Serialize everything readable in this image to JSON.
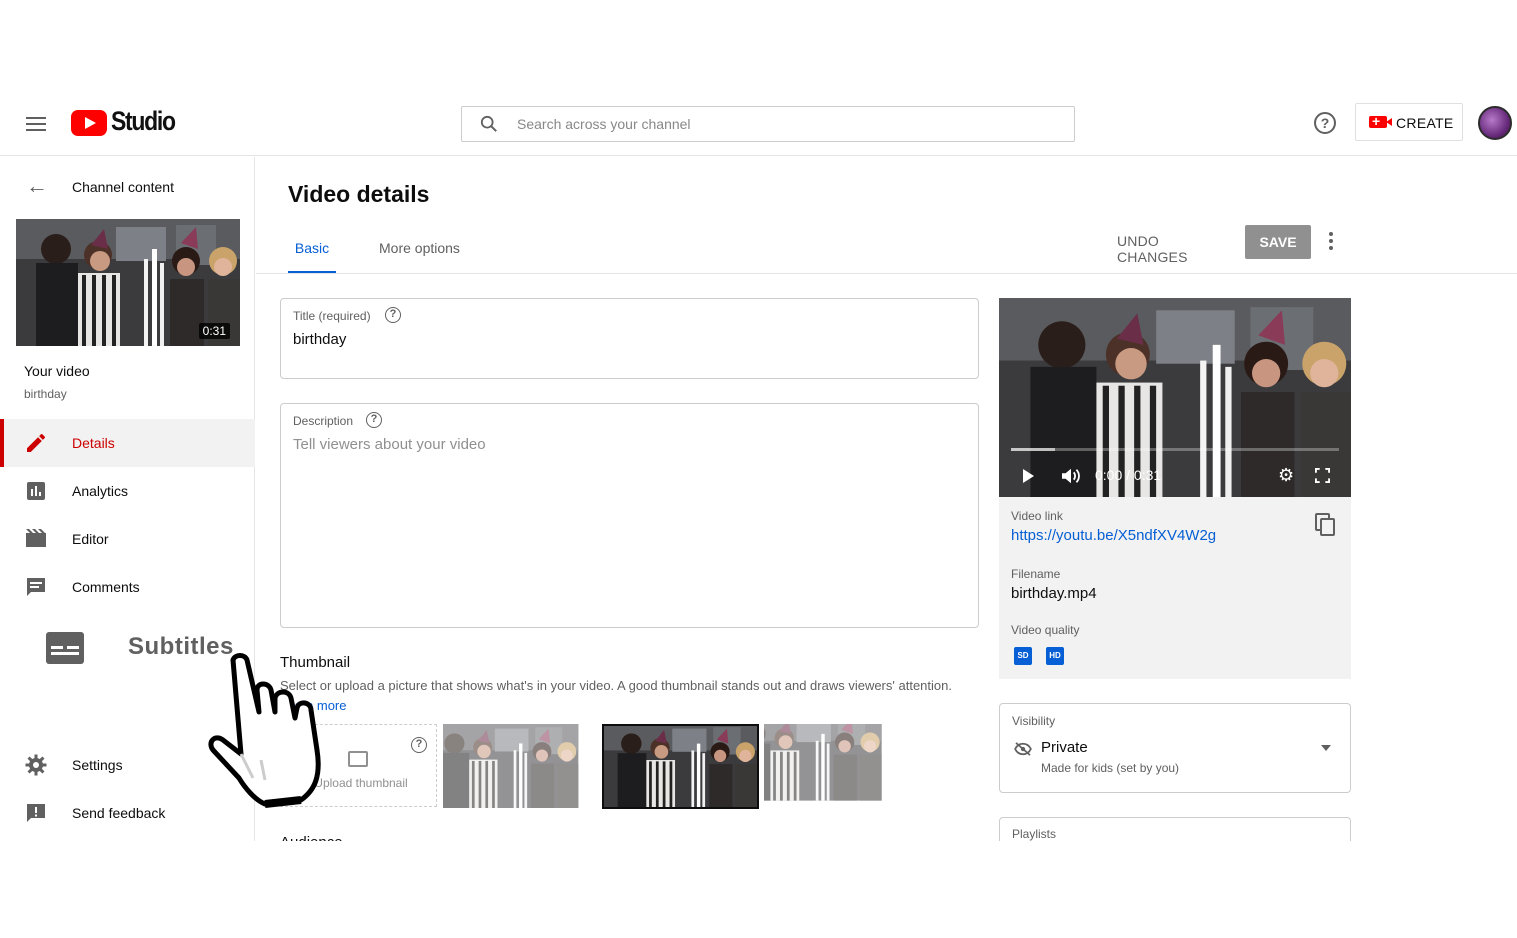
{
  "header": {
    "logo_text": "Studio",
    "search_placeholder": "Search across your channel",
    "help_glyph": "?",
    "create_label": "CREATE"
  },
  "sidebar": {
    "back_label": "Channel content",
    "video_duration": "0:31",
    "your_video_label": "Your video",
    "video_name": "birthday",
    "items": [
      {
        "label": "Details",
        "icon": "pencil-icon",
        "active": true
      },
      {
        "label": "Analytics",
        "icon": "bar-chart-icon",
        "active": false
      },
      {
        "label": "Editor",
        "icon": "clapper-icon",
        "active": false
      },
      {
        "label": "Comments",
        "icon": "comment-icon",
        "active": false
      },
      {
        "label": "Subtitles",
        "icon": "subtitles-icon",
        "active": false
      },
      {
        "label": "Settings",
        "icon": "gear-icon",
        "active": false
      },
      {
        "label": "Send feedback",
        "icon": "feedback-icon",
        "active": false
      }
    ]
  },
  "main": {
    "title": "Video details",
    "tabs": [
      {
        "label": "Basic",
        "active": true
      },
      {
        "label": "More options",
        "active": false
      }
    ],
    "undo_label": "UNDO CHANGES",
    "save_label": "SAVE",
    "title_field": {
      "label": "Title (required)",
      "value": "birthday"
    },
    "description_field": {
      "label": "Description",
      "placeholder": "Tell viewers about your video"
    },
    "thumbnail": {
      "heading": "Thumbnail",
      "description": "Select or upload a picture that shows what's in your video. A good thumbnail stands out and draws viewers' attention.",
      "learn_more": "Learn more",
      "upload_label": "Upload thumbnail"
    },
    "next_section_label": "Audience"
  },
  "player": {
    "time": "0:00 / 0:31"
  },
  "info": {
    "link_label": "Video link",
    "link": "https://youtu.be/X5ndfXV4W2g",
    "filename_label": "Filename",
    "filename": "birthday.mp4",
    "quality_label": "Video quality",
    "quality_badges": [
      "SD",
      "HD"
    ]
  },
  "visibility": {
    "label": "Visibility",
    "value": "Private",
    "sub": "Made for kids (set by you)"
  },
  "playlists": {
    "label": "Playlists"
  },
  "colors": {
    "brand_red": "#ff0000",
    "active_red": "#cc0000",
    "link_blue": "#065fd4",
    "save_disabled": "#909090"
  }
}
